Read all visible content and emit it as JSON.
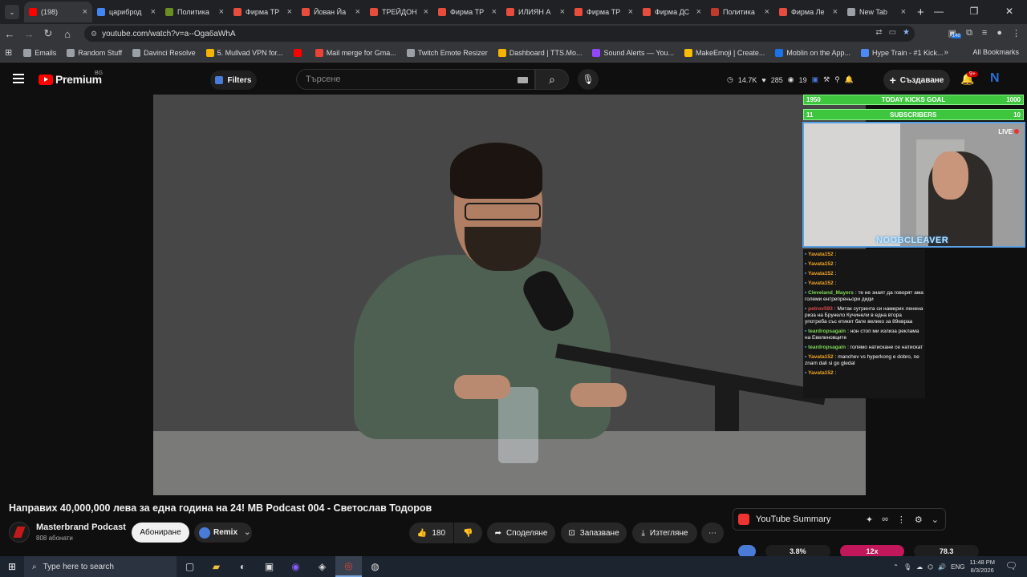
{
  "browser": {
    "tabs": [
      {
        "label": "(198)",
        "favicon_color": "#ff0000",
        "active": true
      },
      {
        "label": "цариброд",
        "favicon_color": "#4285f4"
      },
      {
        "label": "Политика",
        "favicon_color": "#6b8e23"
      },
      {
        "label": "Фирма ТР",
        "favicon_color": "#e74c3c"
      },
      {
        "label": "Йован Йа",
        "favicon_color": "#e74c3c"
      },
      {
        "label": "ТРЕЙДОН",
        "favicon_color": "#e74c3c"
      },
      {
        "label": "Фирма ТР",
        "favicon_color": "#e74c3c"
      },
      {
        "label": "ИЛИЯН А",
        "favicon_color": "#e74c3c"
      },
      {
        "label": "Фирма ТР",
        "favicon_color": "#e74c3c"
      },
      {
        "label": "Фирма ДС",
        "favicon_color": "#e74c3c"
      },
      {
        "label": "Политика",
        "favicon_color": "#c0392b"
      },
      {
        "label": "Фирма Ле",
        "favicon_color": "#e74c3c"
      },
      {
        "label": "New Tab",
        "favicon_color": "#9aa0a6"
      }
    ],
    "url": "youtube.com/watch?v=a--Oga6aWhA",
    "extension_badge": "140",
    "bookmarks": [
      {
        "label": "Emails",
        "color": "#9aa0a6"
      },
      {
        "label": "Random Stuff",
        "color": "#9aa0a6"
      },
      {
        "label": "Davinci Resolve",
        "color": "#9aa0a6"
      },
      {
        "label": "5. Mullvad VPN for...",
        "color": "#f4b400"
      },
      {
        "label": "",
        "color": "#ff0000"
      },
      {
        "label": "Mail merge for Gma...",
        "color": "#ea4335"
      },
      {
        "label": "Twitch Emote Resizer",
        "color": "#9aa0a6"
      },
      {
        "label": "Dashboard | TTS.Mo...",
        "color": "#f4b400"
      },
      {
        "label": "Sound Alerts — You...",
        "color": "#9146ff"
      },
      {
        "label": "MakeEmoji | Create...",
        "color": "#fbbc04"
      },
      {
        "label": "Moblin on the App...",
        "color": "#1a73e8"
      },
      {
        "label": "Hype Train - #1 Kick...",
        "color": "#4c8bf5"
      }
    ],
    "all_bookmarks": "All Bookmarks"
  },
  "youtube": {
    "logo_text": "Premium",
    "region": "BG",
    "filters_label": "Filters",
    "search_placeholder": "Търсене",
    "stats": {
      "views": "14.7K",
      "likes": "285",
      "viewers": "19"
    },
    "create_label": "Създаване",
    "notifications": "9+"
  },
  "overlay": {
    "goal_left": "1950",
    "goal_label": "TODAY KICKS GOAL",
    "goal_right": "1000",
    "subs_left": "11",
    "subs_label": "SUBSCRIBERS",
    "subs_right": "10",
    "live_label": "LIVE",
    "streamer": "NOOBCLEAVER",
    "chat": [
      {
        "user": "Yavata152",
        "text": "",
        "color": "#f5a623"
      },
      {
        "user": "Yavata152",
        "text": "",
        "color": "#f5a623"
      },
      {
        "user": "Yavata152",
        "text": "",
        "color": "#f5a623"
      },
      {
        "user": "Yavata152",
        "text": "",
        "color": "#f5a623"
      },
      {
        "user": "Cleveland_Mayers",
        "text": "те не знаят да говорят ама големи ентрепреньори диди",
        "color": "#7ed957"
      },
      {
        "user": "petrov593",
        "text": "Митак сутринта си намерих ленена риза на Брунело Кучинели в една втора употреба със етикет бате велико за 89евраа",
        "color": "#e04a4a"
      },
      {
        "user": "teardropsagain",
        "text": "нон стоп ми излиза реклама на Евелиновците",
        "color": "#7ed957"
      },
      {
        "user": "teardropsagain",
        "text": "голямо натискане се натискат",
        "color": "#7ed957"
      },
      {
        "user": "Yavata152",
        "text": "manchev vs hyperkong e dobro, ne znam dali si go gledal",
        "color": "#f5a623"
      },
      {
        "user": "Yavata152",
        "text": "",
        "color": "#f5a623"
      }
    ]
  },
  "video": {
    "title": "Направих 40,000,000 лева за една година на 24! MB Podcast 004 - Светослав Тодоров",
    "channel": "Masterbrand Podcast",
    "subscribers": "808 абонати",
    "subscribe_label": "Абониране",
    "remix_label": "Remix",
    "likes": "180",
    "share_label": "Споделяне",
    "save_label": "Запазване",
    "download_label": "Изтегляне"
  },
  "summary": {
    "label": "YouTube Summary",
    "meters": [
      {
        "value": "3.8%",
        "color": "#1e1e1e"
      },
      {
        "value": "12x",
        "color": "#c2185b"
      },
      {
        "value": "78.3",
        "color": "#1e1e1e"
      }
    ]
  },
  "taskbar": {
    "search_placeholder": "Type here to search",
    "lang": "ENG",
    "time": "11:48 PM",
    "date": "8/3/2026"
  }
}
